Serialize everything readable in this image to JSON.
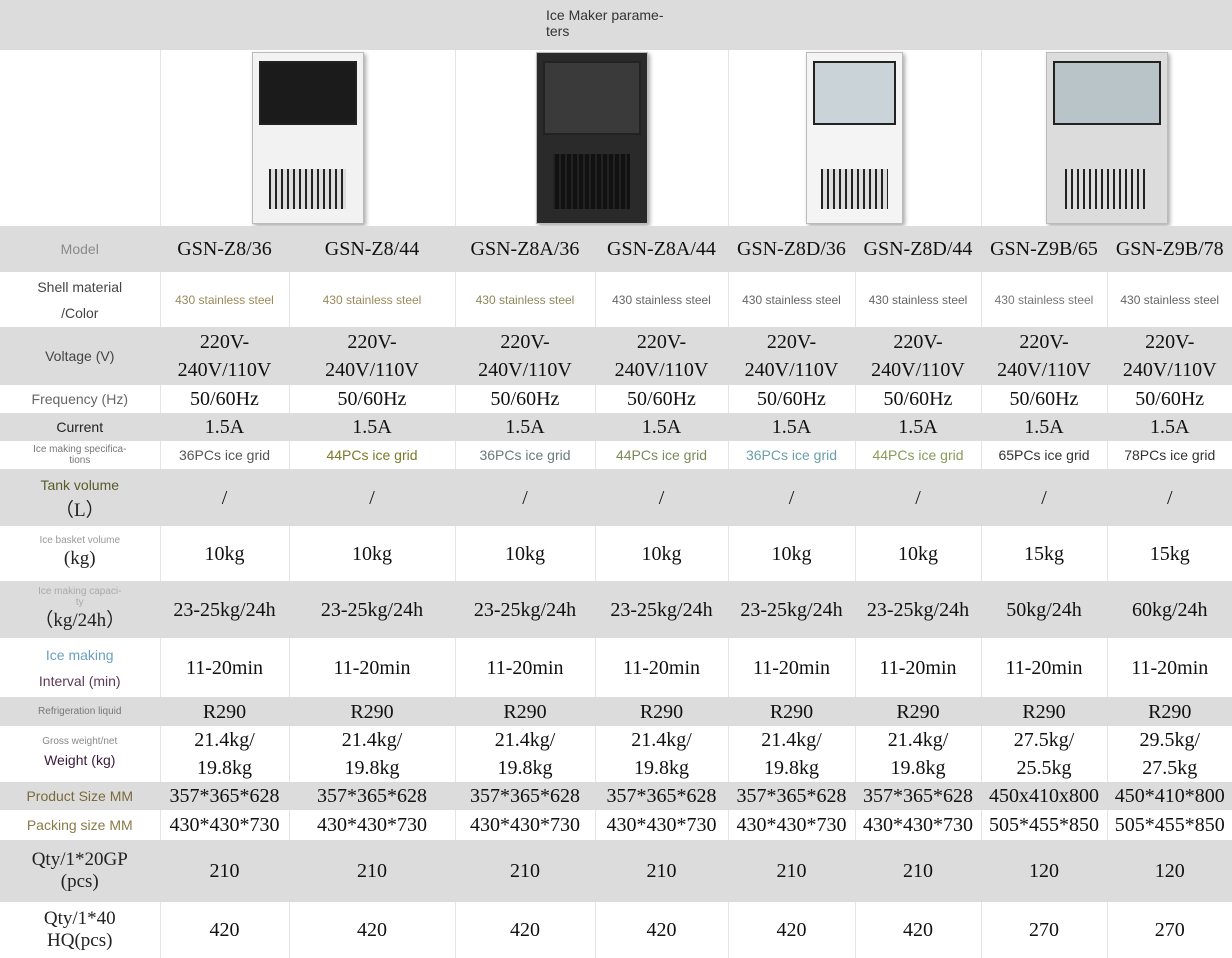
{
  "title": "Ice Maker parame-\nters",
  "products": [
    {
      "name": "white-cabinet-black-door",
      "body": "#f2f2f2",
      "door": "#1b1b1b"
    },
    {
      "name": "black-cabinet",
      "body": "#2a2a2a",
      "door": "#3a3a3a"
    },
    {
      "name": "white-glass-door",
      "body": "#f4f4f4",
      "door": "#c9d3d8"
    },
    {
      "name": "stainless-glass-door",
      "body": "#dcdcdc",
      "door": "#b9c4c8"
    }
  ],
  "rows": [
    {
      "cls": "g",
      "h": 46,
      "label": [
        {
          "t": "Model",
          "c": "#8a8a8a",
          "s": "med"
        }
      ],
      "vc": "val",
      "values": [
        "GSN-Z8/36",
        "GSN-Z8/44",
        "GSN-Z8A/36",
        "GSN-Z8A/44",
        "GSN-Z8D/36",
        "GSN-Z8D/44",
        "GSN-Z9B/65",
        "GSN-Z9B/78"
      ]
    },
    {
      "cls": "w",
      "h": 55,
      "label": [
        {
          "t": "Shell material",
          "c": "#444",
          "s": "med"
        },
        {
          "t": "/Color",
          "c": "#444",
          "s": "med"
        }
      ],
      "vc": "sans",
      "colors": [
        "#9a8a5a",
        "#9a8a5a",
        "#8a8a5a",
        "#666",
        "#666",
        "#666",
        "#777",
        "#666"
      ],
      "values": [
        "430 stainless steel",
        "430 stainless steel",
        "430 stainless steel",
        "430 stainless steel",
        "430 stainless steel",
        "430 stainless steel",
        "430 stainless steel",
        "430 stainless steel"
      ]
    },
    {
      "cls": "g",
      "h": 58,
      "label": [
        {
          "t": "Voltage (V)",
          "c": "#444",
          "s": "med"
        }
      ],
      "vc": "val",
      "values": [
        "220V-\n240V/110V",
        "220V-\n240V/110V",
        "220V-\n240V/110V",
        "220V-\n240V/110V",
        "220V-\n240V/110V",
        "220V-\n240V/110V",
        "220V-\n240V/110V",
        "220V-\n240V/110V"
      ]
    },
    {
      "cls": "w",
      "h": 27,
      "label": [
        {
          "t": "Frequency (Hz)",
          "c": "#666",
          "s": "med"
        }
      ],
      "vc": "val",
      "values": [
        "50/60Hz",
        "50/60Hz",
        "50/60Hz",
        "50/60Hz",
        "50/60Hz",
        "50/60Hz",
        "50/60Hz",
        "50/60Hz"
      ]
    },
    {
      "cls": "g",
      "h": 28,
      "label": [
        {
          "t": "Current",
          "c": "#222",
          "s": "med"
        }
      ],
      "vc": "val",
      "values": [
        "1.5A",
        "1.5A",
        "1.5A",
        "1.5A",
        "1.5A",
        "1.5A",
        "1.5A",
        "1.5A"
      ]
    },
    {
      "cls": "w",
      "h": 28,
      "label": [
        {
          "t": "Ice making specifica-\ntions",
          "c": "#777",
          "s": "small"
        }
      ],
      "vc": "grid",
      "colors": [
        "#555",
        "#7a7a2a",
        "#6a7a7a",
        "#7a8a5a",
        "#6aa0a8",
        "#8a9a5a",
        "#333",
        "#333"
      ],
      "values": [
        "36PCs ice grid",
        "44PCs ice grid",
        "36PCs ice grid",
        "44PCs ice grid",
        "36PCs ice grid",
        "44PCs ice grid",
        "65PCs ice grid",
        "78PCs ice grid"
      ]
    },
    {
      "cls": "g",
      "h": 57,
      "label": [
        {
          "t": "Tank volume",
          "c": "#5a5a2a",
          "s": "med"
        },
        {
          "t": "（L）",
          "c": "#222",
          "s": "big"
        }
      ],
      "vc": "val",
      "values": [
        "/",
        "/",
        "/",
        "/",
        "/",
        "/",
        "/",
        "/"
      ]
    },
    {
      "cls": "w",
      "h": 55,
      "label": [
        {
          "t": "Ice basket volume",
          "c": "#999",
          "s": "small"
        },
        {
          "t": "(kg)",
          "c": "#222",
          "s": "big"
        }
      ],
      "vc": "val",
      "values": [
        "10kg",
        "10kg",
        "10kg",
        "10kg",
        "10kg",
        "10kg",
        "15kg",
        "15kg"
      ]
    },
    {
      "cls": "g",
      "h": 57,
      "label": [
        {
          "t": "Ice making capaci-\nty",
          "c": "#aaa",
          "s": "small"
        },
        {
          "t": "（kg/24h）",
          "c": "#222",
          "s": "big"
        }
      ],
      "vc": "val",
      "values": [
        "23-25kg/24h",
        "23-25kg/24h",
        "23-25kg/24h",
        "23-25kg/24h",
        "23-25kg/24h",
        "23-25kg/24h",
        "50kg/24h",
        "60kg/24h"
      ]
    },
    {
      "cls": "w",
      "h": 59,
      "label": [
        {
          "t": "Ice making",
          "c": "#6aa0c0",
          "s": "med"
        },
        {
          "t": "Interval (min)",
          "c": "#5a3a5a",
          "s": "med"
        }
      ],
      "vc": "val",
      "values": [
        "11-20min",
        "11-20min",
        "11-20min",
        "11-20min",
        "11-20min",
        "11-20min",
        "11-20min",
        "11-20min"
      ]
    },
    {
      "cls": "g",
      "h": 29,
      "label": [
        {
          "t": "Refrigeration liquid",
          "c": "#777",
          "s": "small"
        }
      ],
      "vc": "val",
      "values": [
        "R290",
        "R290",
        "R290",
        "R290",
        "R290",
        "R290",
        "R290",
        "R290"
      ]
    },
    {
      "cls": "w",
      "h": 55,
      "label": [
        {
          "t": "Gross weight/net",
          "c": "#888",
          "s": "small"
        },
        {
          "t": "Weight (kg)",
          "c": "#3a1a3a",
          "s": "med"
        }
      ],
      "vc": "val",
      "values": [
        "21.4kg/\n19.8kg",
        "21.4kg/\n19.8kg",
        "21.4kg/\n19.8kg",
        "21.4kg/\n19.8kg",
        "21.4kg/\n19.8kg",
        "21.4kg/\n19.8kg",
        "27.5kg/\n25.5kg",
        "29.5kg/\n27.5kg"
      ]
    },
    {
      "cls": "g",
      "h": 28,
      "label": [
        {
          "t": "Product Size MM",
          "c": "#7a6a3a",
          "s": "med"
        }
      ],
      "vc": "val",
      "values": [
        "357*365*628",
        "357*365*628",
        "357*365*628",
        "357*365*628",
        "357*365*628",
        "357*365*628",
        "450x410x800",
        "450*410*800"
      ]
    },
    {
      "cls": "w",
      "h": 30,
      "label": [
        {
          "t": "Packing size MM",
          "c": "#8a7a4a",
          "s": "med"
        }
      ],
      "vc": "val",
      "values": [
        "430*430*730",
        "430*430*730",
        "430*430*730",
        "430*430*730",
        "430*430*730",
        "430*430*730",
        "505*455*850",
        "505*455*850"
      ]
    },
    {
      "cls": "g",
      "h": 62,
      "label": [
        {
          "t": "Qty/1*20GP\n(pcs)",
          "c": "#222",
          "s": "big"
        }
      ],
      "vc": "val",
      "values": [
        "210",
        "210",
        "210",
        "210",
        "210",
        "210",
        "120",
        "120"
      ]
    },
    {
      "cls": "w",
      "h": 56,
      "label": [
        {
          "t": "Qty/1*40\nHQ(pcs)",
          "c": "#222",
          "s": "big"
        }
      ],
      "vc": "val",
      "values": [
        "420",
        "420",
        "420",
        "420",
        "420",
        "420",
        "270",
        "270"
      ]
    }
  ]
}
